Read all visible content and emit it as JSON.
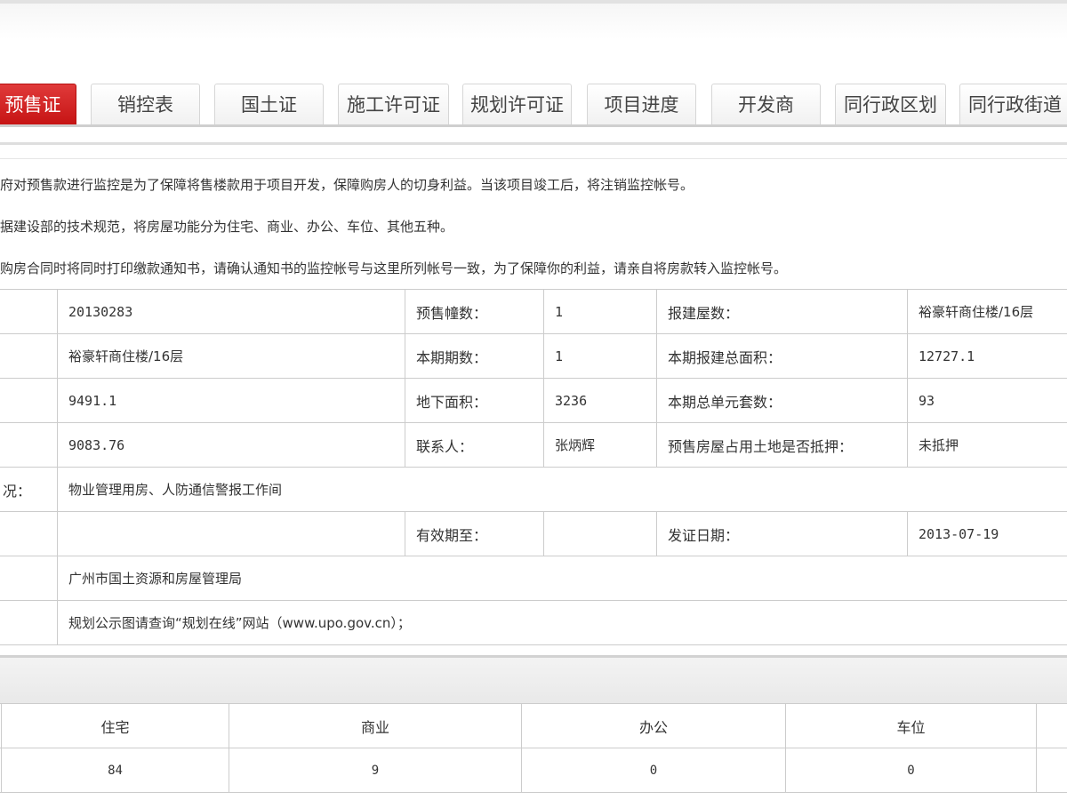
{
  "tabs": [
    {
      "label": "预售证",
      "active": true
    },
    {
      "label": "销控表",
      "active": false
    },
    {
      "label": "国土证",
      "active": false
    },
    {
      "label": "施工许可证",
      "active": false
    },
    {
      "label": "规划许可证",
      "active": false
    },
    {
      "label": "项目进度",
      "active": false
    },
    {
      "label": "开发商",
      "active": false
    },
    {
      "label": "同行政区划",
      "active": false
    },
    {
      "label": "同行政街道",
      "active": false
    }
  ],
  "notices": [
    "府对预售款进行监控是为了保障将售楼款用于项目开发，保障购房人的切身利益。当该项目竣工后，将注销监控帐号。",
    "据建设部的技术规范，将房屋功能分为住宅、商业、办公、车位、其他五种。",
    "购房合同时将同时打印缴款通知书，请确认通知书的监控帐号与这里所列帐号一致，为了保障你的利益，请亲自将房款转入监控帐号。"
  ],
  "info": {
    "r1": {
      "c0": "",
      "v1": "20130283",
      "l2": "预售幢数：",
      "v2": "1",
      "l3": "报建屋数：",
      "v3": "裕豪轩商住楼/16层"
    },
    "r2": {
      "c0": "",
      "v1": "裕豪轩商住楼/16层",
      "l2": "本期期数：",
      "v2": "1",
      "l3": "本期报建总面积：",
      "v3": "12727.1"
    },
    "r3": {
      "c0": "",
      "v1": "9491.1",
      "l2": "地下面积：",
      "v2": "3236",
      "l3": "本期总单元套数：",
      "v3": "93"
    },
    "r4": {
      "c0": "",
      "v1": "9083.76",
      "l2": "联系人：",
      "v2": "张炳辉",
      "l3": "预售房屋占用土地是否抵押：",
      "v3": "未抵押"
    },
    "r5": {
      "c0": "况：",
      "v1": "物业管理用房、人防通信警报工作间"
    },
    "r6": {
      "c0": "",
      "v1": "",
      "l2": "有效期至：",
      "v2": "",
      "l3": "发证日期：",
      "v3": "2013-07-19"
    },
    "r7": {
      "c0": "",
      "v1": "广州市国土资源和房屋管理局"
    },
    "r8": {
      "c0": "",
      "v1": "规划公示图请查询“规划在线”网站（www.upo.gov.cn）；"
    }
  },
  "functions": {
    "headers": [
      "",
      "住宅",
      "商业",
      "办公",
      "车位",
      ""
    ],
    "values": [
      "",
      "84",
      "9",
      "0",
      "0",
      ""
    ]
  },
  "colors": {
    "active_tab": "#d42222",
    "border": "#cccccc"
  }
}
